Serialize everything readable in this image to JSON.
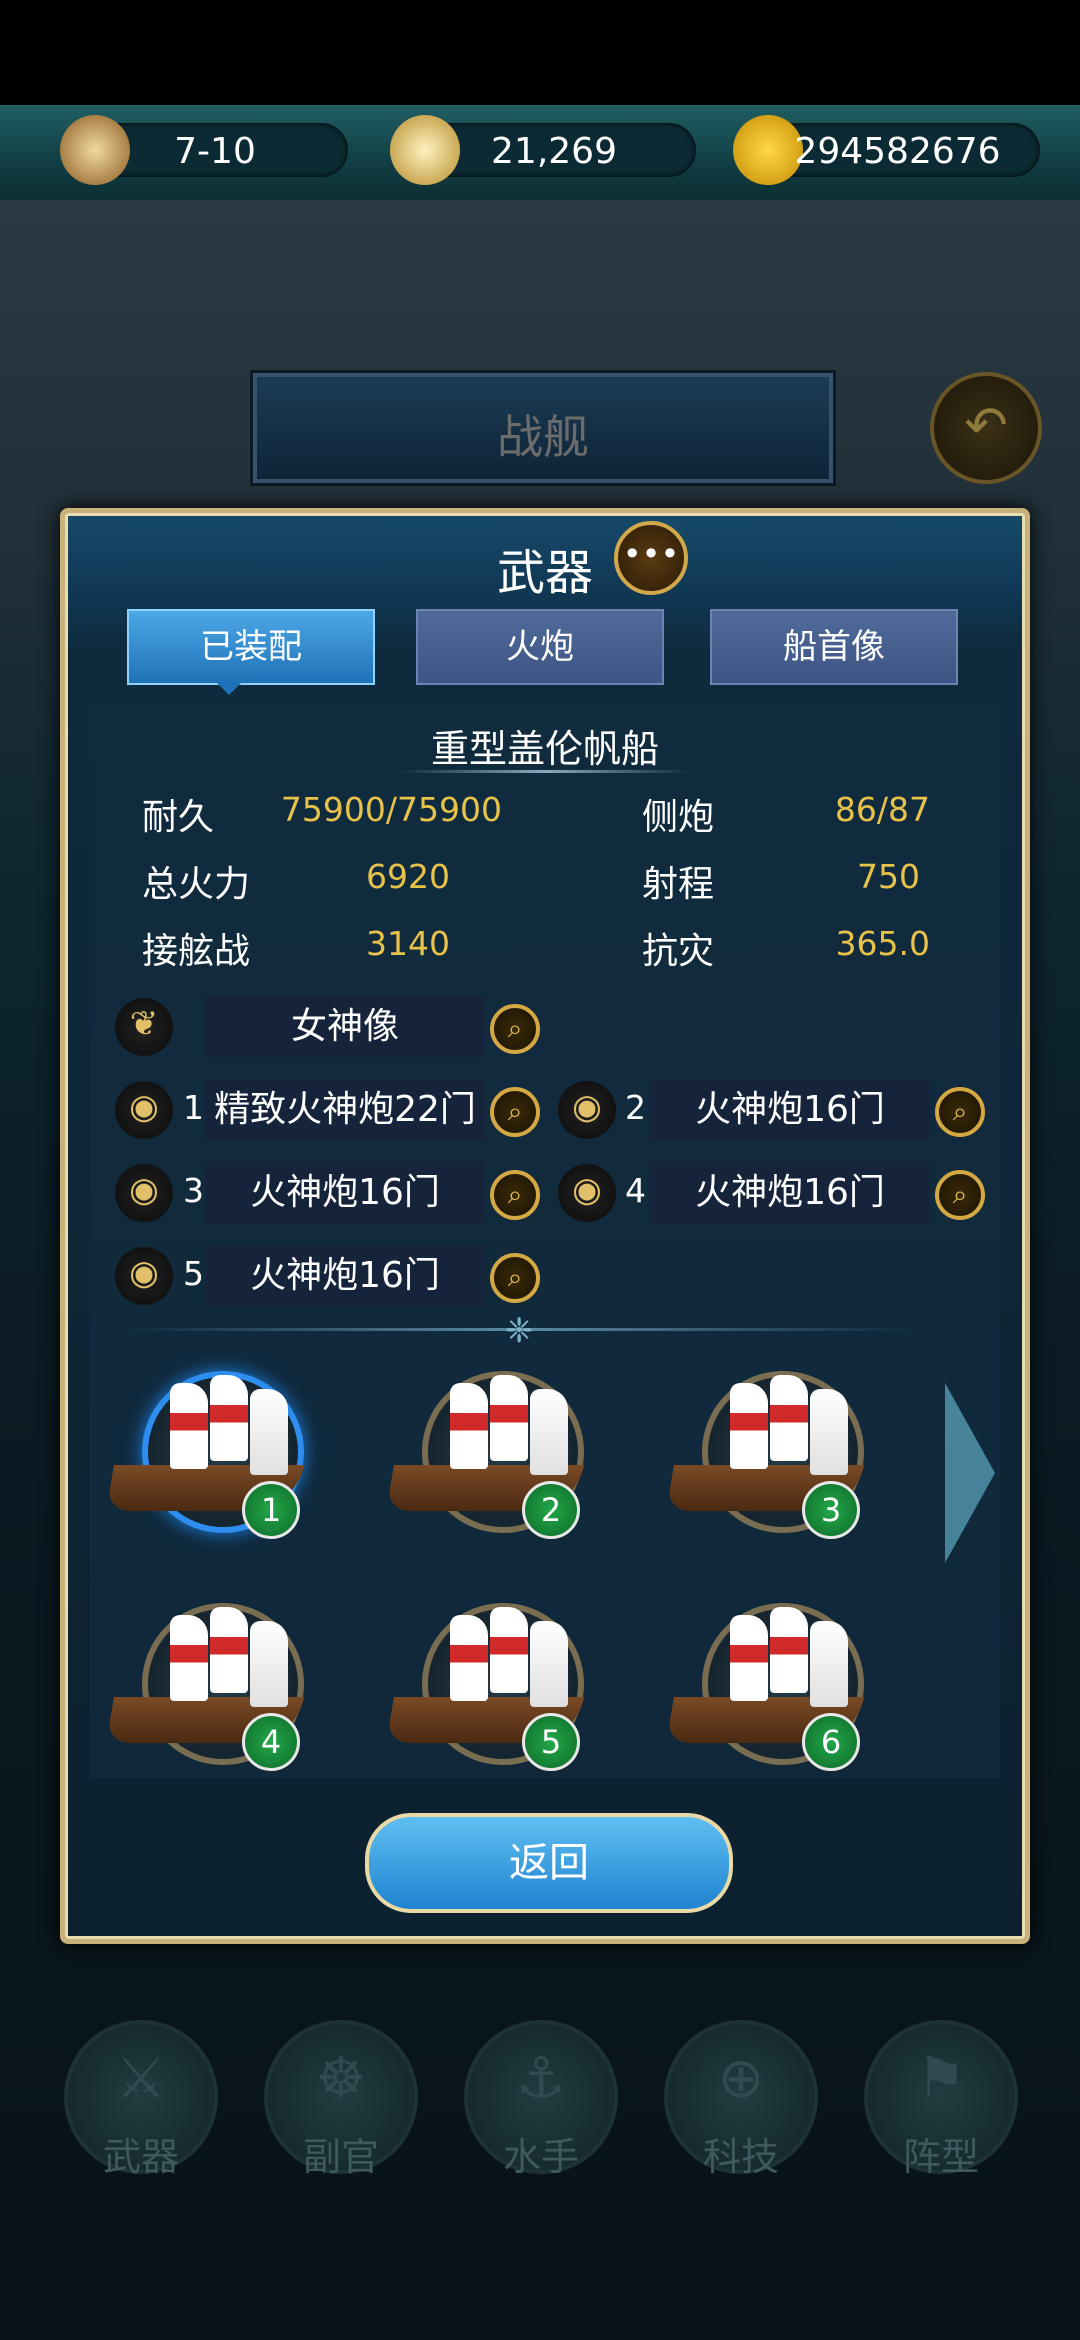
{
  "resources": {
    "time": "7-10",
    "compass": "21,269",
    "gold": "294582676"
  },
  "banner": {
    "title": "战舰"
  },
  "panel": {
    "title": "武器",
    "tabs": [
      {
        "label": "已装配"
      },
      {
        "label": "火炮"
      },
      {
        "label": "船首像"
      }
    ],
    "ship_name": "重型盖伦帆船",
    "stats": {
      "durability_label": "耐久",
      "durability_value": "75900/75900",
      "side_cannon_label": "侧炮",
      "side_cannon_value": "86/87",
      "firepower_label": "总火力",
      "firepower_value": "6920",
      "range_label": "射程",
      "range_value": "750",
      "boarding_label": "接舷战",
      "boarding_value": "3140",
      "disaster_label": "抗灾",
      "disaster_value": "365.0"
    },
    "figurehead": {
      "name": "女神像"
    },
    "cannons": [
      {
        "num": "1",
        "name": "精致火神炮22门"
      },
      {
        "num": "2",
        "name": "火神炮16门"
      },
      {
        "num": "3",
        "name": "火神炮16门"
      },
      {
        "num": "4",
        "name": "火神炮16门"
      },
      {
        "num": "5",
        "name": "火神炮16门"
      }
    ],
    "ships": [
      {
        "num": "1"
      },
      {
        "num": "2"
      },
      {
        "num": "3"
      },
      {
        "num": "4"
      },
      {
        "num": "5"
      },
      {
        "num": "6"
      }
    ],
    "return_label": "返回"
  },
  "bottom_nav": [
    {
      "label": "武器"
    },
    {
      "label": "副官"
    },
    {
      "label": "水手"
    },
    {
      "label": "科技"
    },
    {
      "label": "阵型"
    }
  ]
}
